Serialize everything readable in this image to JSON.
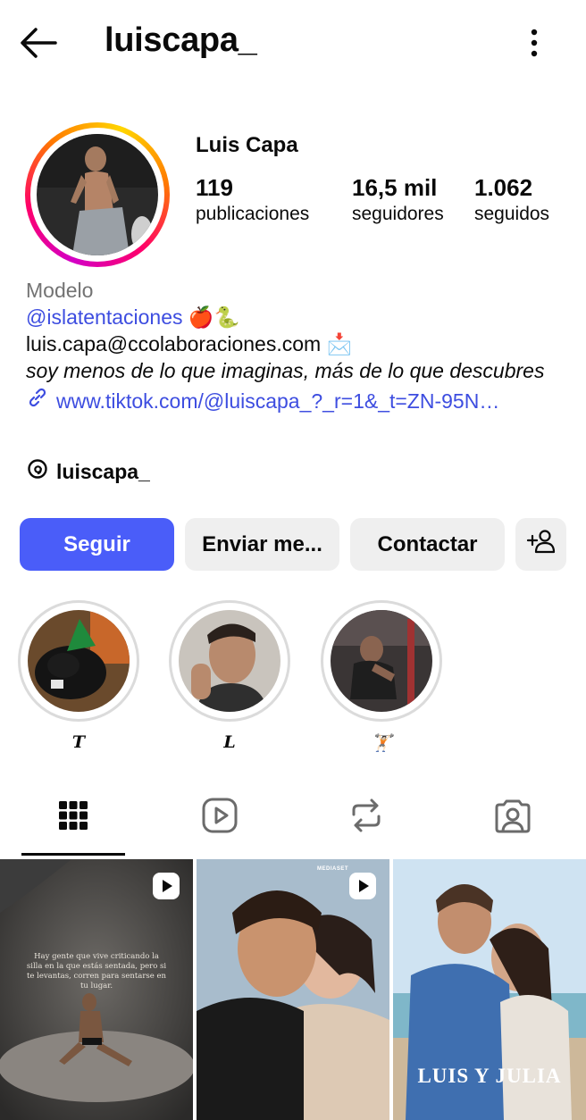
{
  "header": {
    "username": "luiscapa_"
  },
  "profile": {
    "name": "Luis Capa",
    "stats": [
      {
        "value": "119",
        "label": "publicaciones"
      },
      {
        "value": "16,5 mil",
        "label": "seguidores"
      },
      {
        "value": "1.062",
        "label": "seguidos"
      }
    ]
  },
  "bio": {
    "category": "Modelo",
    "mention": "@islatentaciones",
    "mention_emoji": "🍎🐍",
    "email": "luis.capa@ccolaboraciones.com",
    "email_emoji": "📩",
    "tagline_italic": "soy menos de lo que imaginas",
    "tagline_rest": ", más de lo que descubres",
    "link": "www.tiktok.com/@luiscapa_?_r=1&_t=ZN-95N…",
    "threads_handle": "luiscapa_"
  },
  "buttons": {
    "follow": "Seguir",
    "message": "Enviar me...",
    "contact": "Contactar"
  },
  "highlights": [
    {
      "label": "T"
    },
    {
      "label": "L"
    },
    {
      "label": "🏋🏻"
    }
  ],
  "tabs": [
    {
      "icon": "grid-icon",
      "active": true
    },
    {
      "icon": "reels-icon",
      "active": false
    },
    {
      "icon": "reposts-icon",
      "active": false
    },
    {
      "icon": "tagged-icon",
      "active": false
    }
  ],
  "posts": [
    {
      "type": "reel",
      "text": "Hay gente que vive criticando la silla en la que estás sentada, pero si te levantas, corren para sentarse en tu lugar."
    },
    {
      "type": "reel",
      "badge": "MEDIASET"
    },
    {
      "type": "image",
      "title": "LUIS Y JULIA"
    }
  ],
  "colors": {
    "follow_button": "#4a5df9",
    "link": "#3d4de0",
    "secondary_button": "#efefef",
    "muted_text": "#737373"
  }
}
